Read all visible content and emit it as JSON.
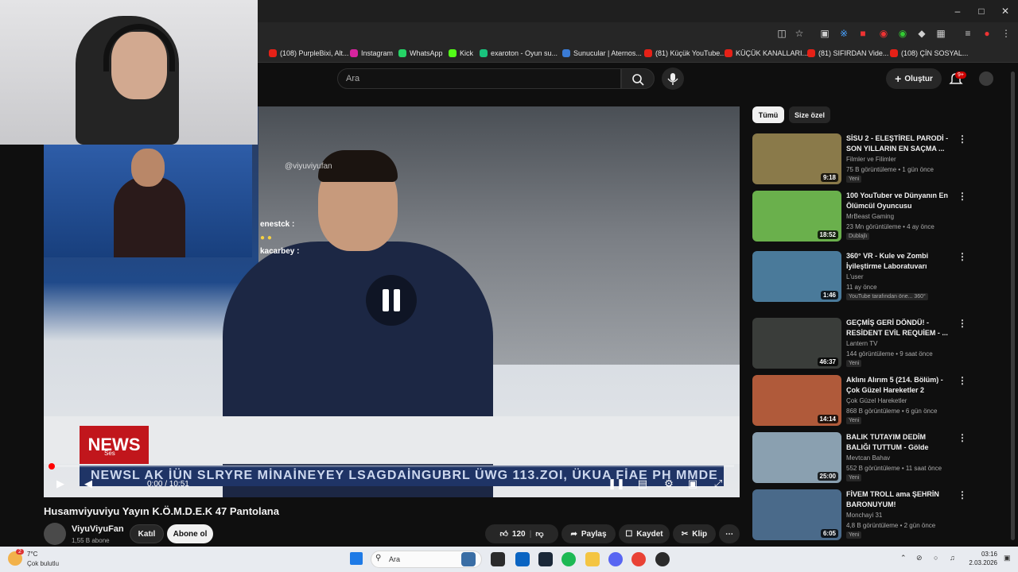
{
  "browser": {
    "bookmarks": [
      {
        "label": "(108) PurpleBixi, Alt...",
        "color": "#e62117"
      },
      {
        "label": "Instagram",
        "color": "#d6249f"
      },
      {
        "label": "WhatsApp",
        "color": "#25d366"
      },
      {
        "label": "Kick",
        "color": "#53fc18"
      },
      {
        "label": "exaroton - Oyun su...",
        "color": "#19c37d"
      },
      {
        "label": "Sunucular | Aternos...",
        "color": "#3a7bd5"
      },
      {
        "label": "(81) Küçük YouTube...",
        "color": "#e62117"
      },
      {
        "label": "KÜÇÜK KANALLARI...",
        "color": "#e62117"
      },
      {
        "label": "(81) SIFIRDAN Vide...",
        "color": "#e62117"
      },
      {
        "label": "(108) ÇİN SOSYAL...",
        "color": "#e62117"
      }
    ]
  },
  "youtube": {
    "search_placeholder": "Ara",
    "create_label": "Oluştur",
    "notif_badge": "9+",
    "chips": [
      "Tümü",
      "Size özel"
    ],
    "video": {
      "title": "Husamviyuviyu Yayın K.Ö.M.D.E.K 47 Pantolana",
      "time": "0:00 / 10:51",
      "volume_tooltip": "Ses",
      "watermark": "@viyuviyufan",
      "news_label": "NEWS",
      "ticker": "NEWSL  AK İÜN SLRYRE MİNAİNEYEY LSAGDAİNGUBRL  ÜWG 113.ZOI, ÜKUA   FİAE PH MMDE",
      "chat_lines": [
        "enestck :",
        "kacarbey :"
      ]
    },
    "channel": {
      "name": "ViyuViyuFan",
      "subscribers": "1,55 B abone",
      "join_label": "Katıl",
      "subscribe_label": "Abone ol"
    },
    "actions": {
      "likes": "120",
      "share": "Paylaş",
      "save": "Kaydet",
      "clip": "Klip"
    },
    "recommendations": [
      {
        "title": "SİSU 2 - ELEŞTİREL PARODİ - SON YILLARIN EN SAÇMA ...",
        "channel": "Filmler ve Filimler",
        "meta": "75 B görüntüleme • 1 gün önce",
        "tag": "Yeni",
        "duration": "9:18",
        "thumb_color": "#8a7a4a"
      },
      {
        "title": "100 YouTuber ve Dünyanın En Ölümcül Oyuncusu",
        "channel": "MrBeast Gaming",
        "meta": "23 Mn görüntüleme • 4 ay önce",
        "tag": "Dublajlı",
        "duration": "18:52",
        "thumb_color": "#6ab04c"
      },
      {
        "title": "360° VR - Kule ve Zombi İyileştirme Laboratuvarı",
        "channel": "L'user",
        "meta": "11 ay önce",
        "tag": "YouTube tarafından öne... 360°",
        "duration": "1:46",
        "thumb_color": "#4a7a9a"
      },
      {
        "title": "GEÇMİŞ GERİ DÖNDÜ! - RESİDENT EVİL REQUİEM - ...",
        "channel": "Lantern TV",
        "meta": "144 görüntüleme • 9 saat önce",
        "tag": "Yeni",
        "duration": "46:37",
        "thumb_color": "#3a3d3a"
      },
      {
        "title": "Aklını Alırım 5 (214. Bölüm) - Çok Güzel Hareketler 2",
        "channel": "Çok Güzel Hareketler",
        "meta": "868 B görüntüleme • 6 gün önce",
        "tag": "Yeni",
        "duration": "14:14",
        "thumb_color": "#b05a3a"
      },
      {
        "title": "BALIK TUTAYIM DEDİM BALIĞI TUTTUM - Gölde hipotermi keyfi",
        "channel": "Mevtcan Bahav",
        "meta": "552 B görüntüleme • 11 saat önce",
        "tag": "Yeni",
        "duration": "25:00",
        "thumb_color": "#8aa0b0"
      },
      {
        "title": "FİVEM TROLL ama ŞEHRİN BARONUYUM!",
        "channel": "Monchayi 31",
        "meta": "4,8 B görüntüleme • 2 gün önce",
        "tag": "Yeni",
        "duration": "6:05",
        "thumb_color": "#4a6a8a"
      }
    ]
  },
  "taskbar": {
    "weather_temp": "7°C",
    "weather_desc": "Çok bulutlu",
    "weather_badge": "2",
    "search_label": "Ara",
    "time": "03:16",
    "date": "2.03.2026"
  }
}
